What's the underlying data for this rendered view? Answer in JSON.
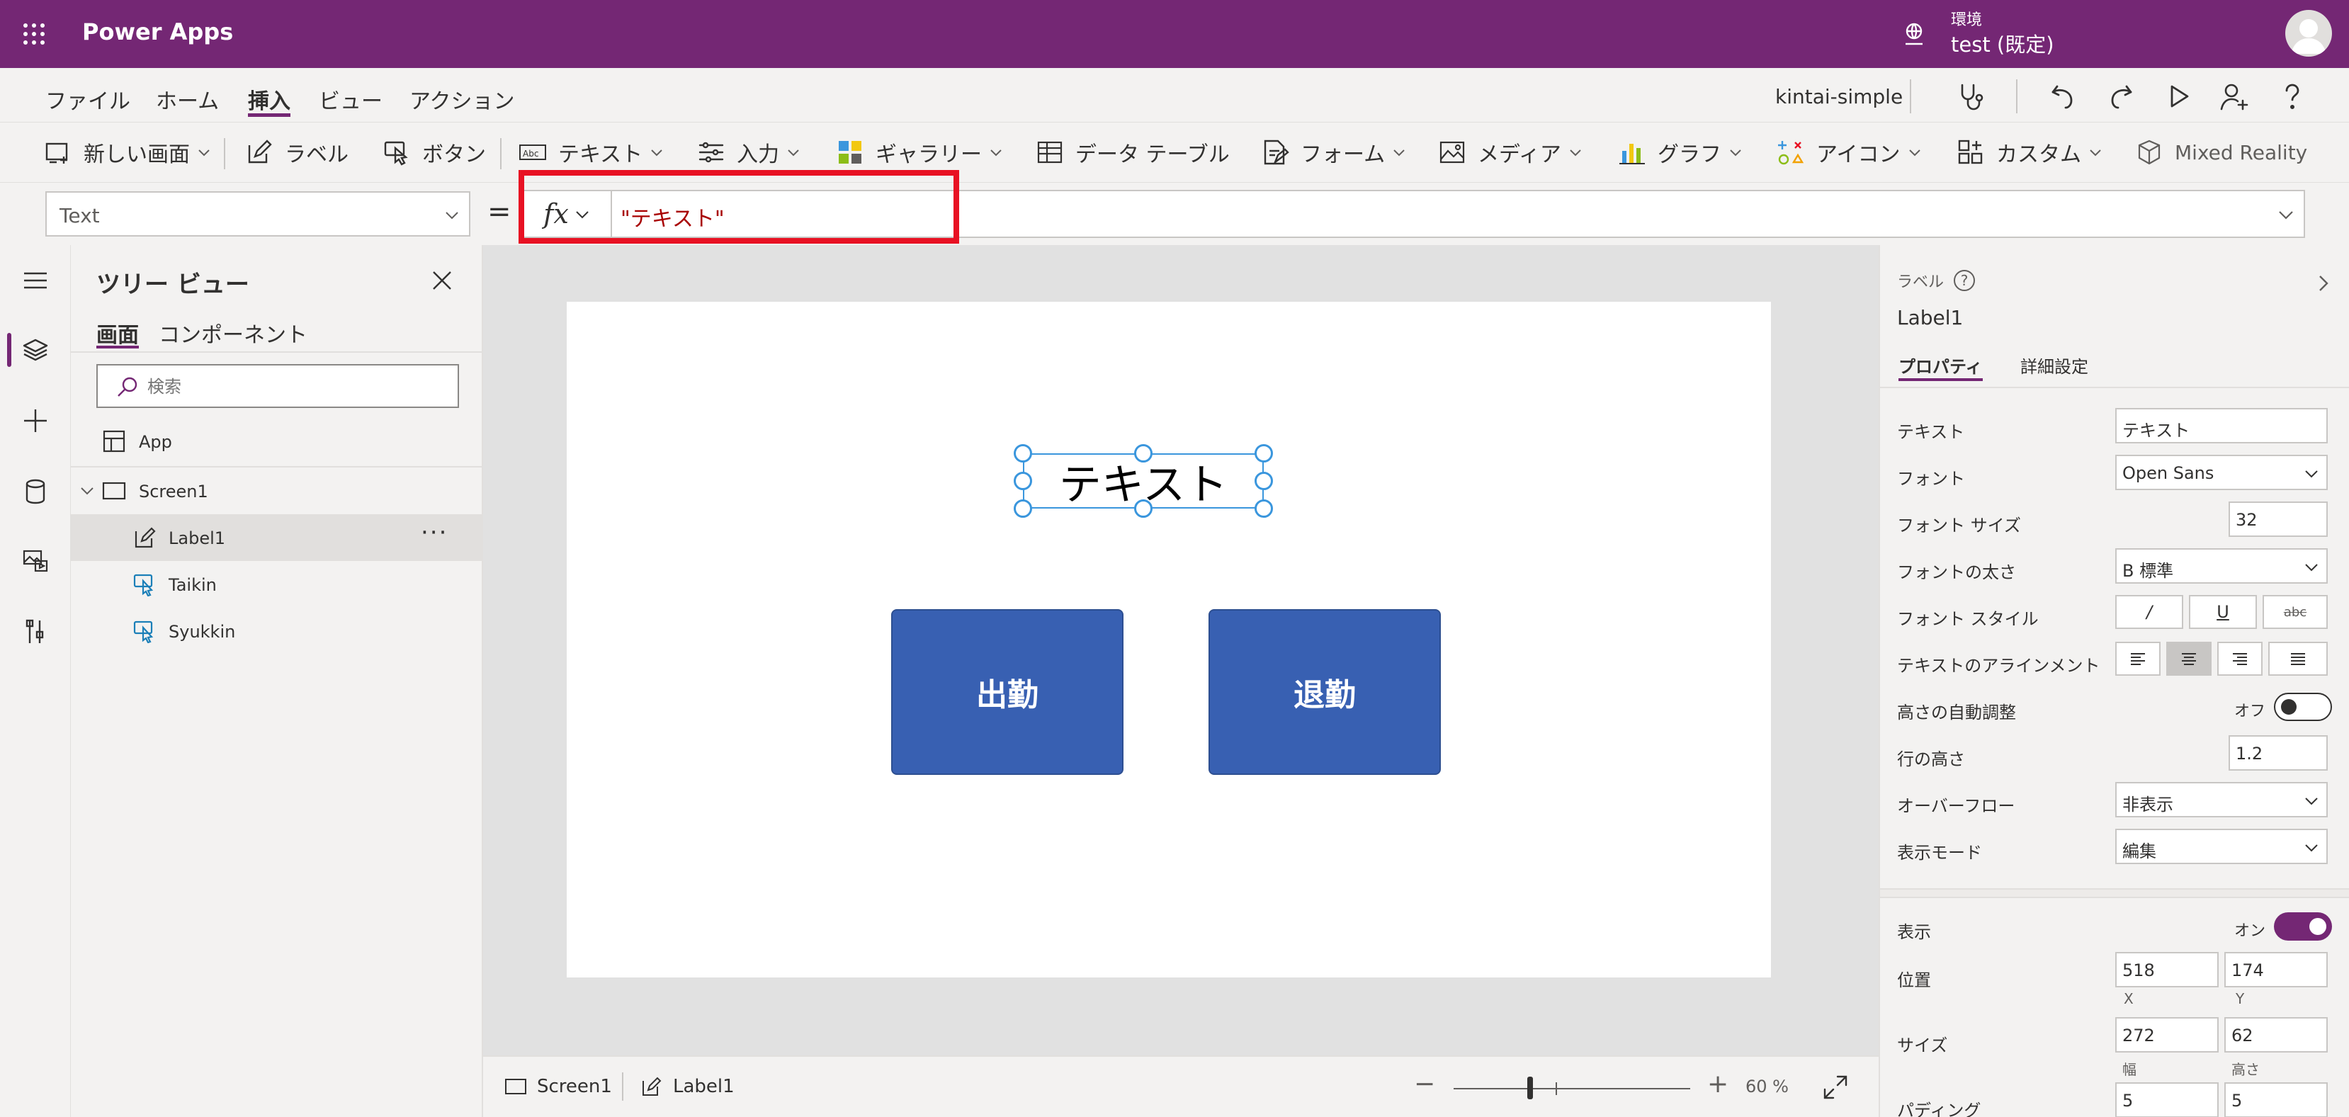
{
  "header": {
    "app_title": "Power Apps",
    "env_label": "環境",
    "env_name": "test (既定)"
  },
  "menu": {
    "items": [
      "ファイル",
      "ホーム",
      "挿入",
      "ビュー",
      "アクション"
    ],
    "active": "挿入",
    "app_name": "kintai-simple"
  },
  "ribbon": {
    "new_screen": "新しい画面",
    "label": "ラベル",
    "button": "ボタン",
    "text": "テキスト",
    "input": "入力",
    "gallery": "ギャラリー",
    "data_table": "データ テーブル",
    "form": "フォーム",
    "media": "メディア",
    "chart": "グラフ",
    "icons": "アイコン",
    "custom": "カスタム",
    "mixed_reality": "Mixed Reality"
  },
  "formula": {
    "property": "Text",
    "equals": "=",
    "fx": "fx",
    "value": "\"テキスト\""
  },
  "tree": {
    "title": "ツリー ビュー",
    "tab_screens": "画面",
    "tab_components": "コンポーネント",
    "search_placeholder": "検索",
    "app": "App",
    "screen1": "Screen1",
    "label1": "Label1",
    "taikin": "Taikin",
    "syukkin": "Syukkin",
    "more": "···"
  },
  "canvas": {
    "label_text": "テキスト",
    "btn_checkin": "出勤",
    "btn_checkout": "退勤"
  },
  "bottom": {
    "screen": "Screen1",
    "control": "Label1",
    "zoom_minus": "−",
    "zoom_plus": "+",
    "zoom_value": "60 %",
    "zoom_percent": 60
  },
  "props": {
    "control_type": "ラベル",
    "help": "?",
    "control_name": "Label1",
    "tab_properties": "プロパティ",
    "tab_advanced": "詳細設定",
    "text_label": "テキスト",
    "text_value": "テキスト",
    "font_label": "フォント",
    "font_value": "Open Sans",
    "font_size_label": "フォント サイズ",
    "font_size_value": "32",
    "font_weight_label": "フォントの太さ",
    "font_weight_value": "B  標準",
    "font_style_label": "フォント スタイル",
    "italic": "/",
    "underline": "U",
    "strike": "abc",
    "align_label": "テキストのアラインメント",
    "autoheight_label": "高さの自動調整",
    "autoheight_state": "オフ",
    "line_height_label": "行の高さ",
    "line_height_value": "1.2",
    "overflow_label": "オーバーフロー",
    "overflow_value": "非表示",
    "display_mode_label": "表示モード",
    "display_mode_value": "編集",
    "visible_label": "表示",
    "visible_state": "オン",
    "position_label": "位置",
    "pos_x": "518",
    "pos_y": "174",
    "pos_x_label": "X",
    "pos_y_label": "Y",
    "size_label": "サイズ",
    "width": "272",
    "height": "62",
    "width_label": "幅",
    "height_label": "高さ",
    "padding_label": "パディング",
    "pad_top": "5",
    "pad_bottom": "5"
  },
  "colors": {
    "brand": "#742774",
    "button_fill": "#3860b2",
    "selection": "#3a96dd",
    "highlight": "#e81123"
  }
}
